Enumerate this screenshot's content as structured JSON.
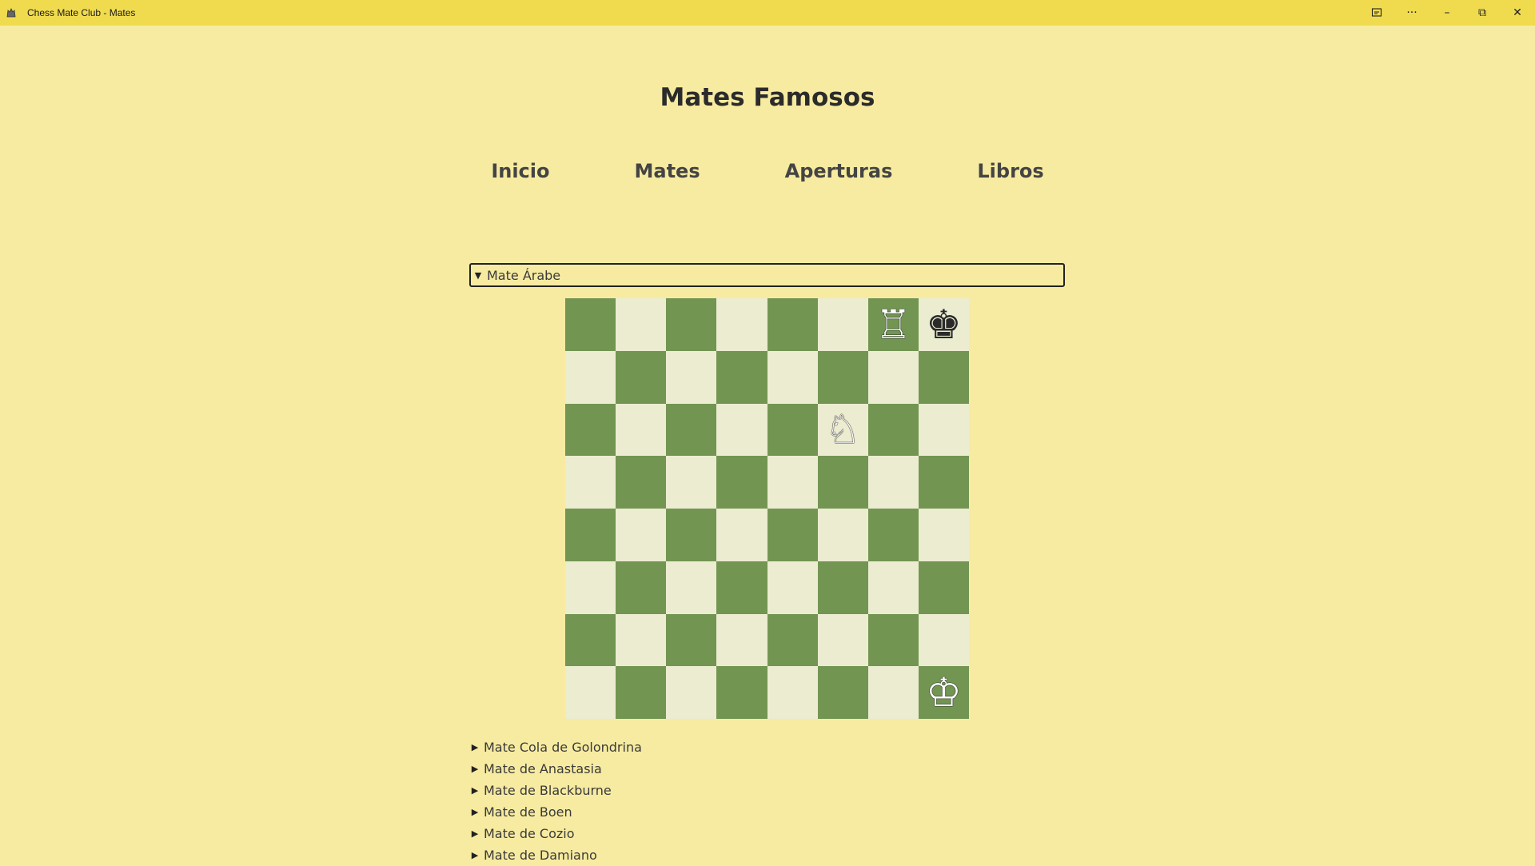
{
  "window": {
    "title": "Chess Mate Club - Mates",
    "controls": {
      "cast_icon": "cast-icon",
      "more": "···",
      "minimize": "–",
      "restore": "⧉",
      "close": "✕"
    }
  },
  "page": {
    "title": "Mates Famosos"
  },
  "nav": {
    "items": [
      {
        "label": "Inicio"
      },
      {
        "label": "Mates"
      },
      {
        "label": "Aperturas"
      },
      {
        "label": "Libros"
      }
    ]
  },
  "mates": {
    "open": {
      "label": "Mate Árabe",
      "board": {
        "light_color": "#ebecd0",
        "dark_color": "#739552",
        "pieces": [
          {
            "square": "g8",
            "glyph": "♖",
            "color": "white",
            "name": "rook"
          },
          {
            "square": "h8",
            "glyph": "♚",
            "color": "black",
            "name": "king"
          },
          {
            "square": "f6",
            "glyph": "♘",
            "color": "white",
            "name": "knight"
          },
          {
            "square": "h1",
            "glyph": "♔",
            "color": "white",
            "name": "king"
          }
        ]
      }
    },
    "collapsed": [
      {
        "label": "Mate Cola de Golondrina"
      },
      {
        "label": "Mate de Anastasia"
      },
      {
        "label": "Mate de Blackburne"
      },
      {
        "label": "Mate de Boen"
      },
      {
        "label": "Mate de Cozio"
      },
      {
        "label": "Mate de Damiano"
      }
    ]
  },
  "colors": {
    "background": "#f7eba1",
    "titlebar": "#f0db4f"
  }
}
